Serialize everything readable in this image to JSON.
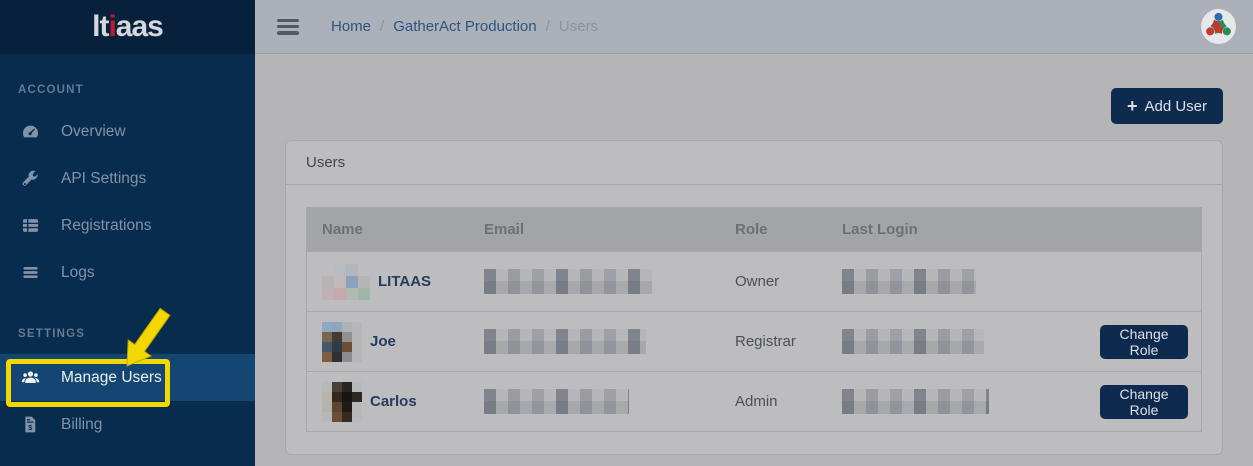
{
  "logo": {
    "prefix": "lt",
    "accent": "i",
    "suffix": "aas"
  },
  "sidebar": {
    "sections": [
      {
        "label": "ACCOUNT",
        "items": [
          {
            "label": "Overview",
            "icon": "gauge-icon"
          },
          {
            "label": "API Settings",
            "icon": "wrench-icon"
          },
          {
            "label": "Registrations",
            "icon": "table-list-icon"
          },
          {
            "label": "Logs",
            "icon": "lines-icon"
          }
        ]
      },
      {
        "label": "SETTINGS",
        "items": [
          {
            "label": "Manage Users",
            "icon": "users-icon",
            "active": true
          },
          {
            "label": "Billing",
            "icon": "invoice-dollar-icon"
          }
        ]
      }
    ]
  },
  "topbar": {
    "breadcrumb": {
      "home": "Home",
      "project": "GatherAct Production",
      "current": "Users",
      "separator": "/"
    }
  },
  "toolbar": {
    "plus": "+",
    "add_user_label": "Add User"
  },
  "card": {
    "title": "Users"
  },
  "table": {
    "headers": {
      "name": "Name",
      "email": "Email",
      "role": "Role",
      "last_login": "Last Login"
    },
    "change_role_label": "Change Role",
    "rows": [
      {
        "name": "LITAAS",
        "role": "Owner",
        "email_redacted": true,
        "last_login_redacted": true,
        "has_change_role": false,
        "avatar": [
          [
            "",
            "#b9bbbe",
            "#b2b6bf",
            ""
          ],
          [
            "#b9b1b3",
            "#c3b7b8",
            "#8ca1bd",
            "#b5b5b7"
          ],
          [
            "#c0b2b4",
            "#c5a9ab",
            "#b1b9b3",
            "#9fb5a5"
          ]
        ]
      },
      {
        "name": "Joe",
        "role": "Registrar",
        "email_redacted": true,
        "last_login_redacted": true,
        "has_change_role": true,
        "avatar": [
          [
            "#8fa9c2",
            "#92a4b9",
            "#aeb2b7",
            "#b6b7b9"
          ],
          [
            "#7b6550",
            "#423b34",
            "#8e9092",
            "#b6b7b9"
          ],
          [
            "#46586a",
            "#313b45",
            "#6f4e38",
            "#b6b7b9"
          ],
          [
            "#7d5e44",
            "#303032",
            "#8a8c8e",
            "#b6b7b9"
          ]
        ]
      },
      {
        "name": "Carlos",
        "role": "Admin",
        "email_redacted": true,
        "last_login_redacted": true,
        "has_change_role": true,
        "avatar": [
          [
            "#b7b8ba",
            "#4a4038",
            "#2b2522",
            "#b7b8ba"
          ],
          [
            "#b9b3ae",
            "#33291f",
            "#181512",
            "#2f2721"
          ],
          [
            "#b8b2ad",
            "#5c4433",
            "#201a16",
            "#b7b8ba"
          ],
          [
            "#b7b8ba",
            "#6e4c38",
            "#382a20",
            "#b7b8ba"
          ]
        ]
      }
    ]
  },
  "annotation": {
    "type": "highlight-box-with-arrow",
    "target": "Manage Users"
  },
  "colors": {
    "sidebar_navy": "#082c4d",
    "sidebar_header_navy": "#07213d",
    "active_item_blue": "#134672",
    "button_navy": "#0e2b4f",
    "highlight_yellow": "#f2d800",
    "logo_accent_red": "#c11b2b",
    "link_blue": "#2c5480",
    "avatar_logo_blue": "#2e6bb0",
    "avatar_logo_red": "#c13a2e",
    "avatar_logo_green": "#2f8a51"
  }
}
